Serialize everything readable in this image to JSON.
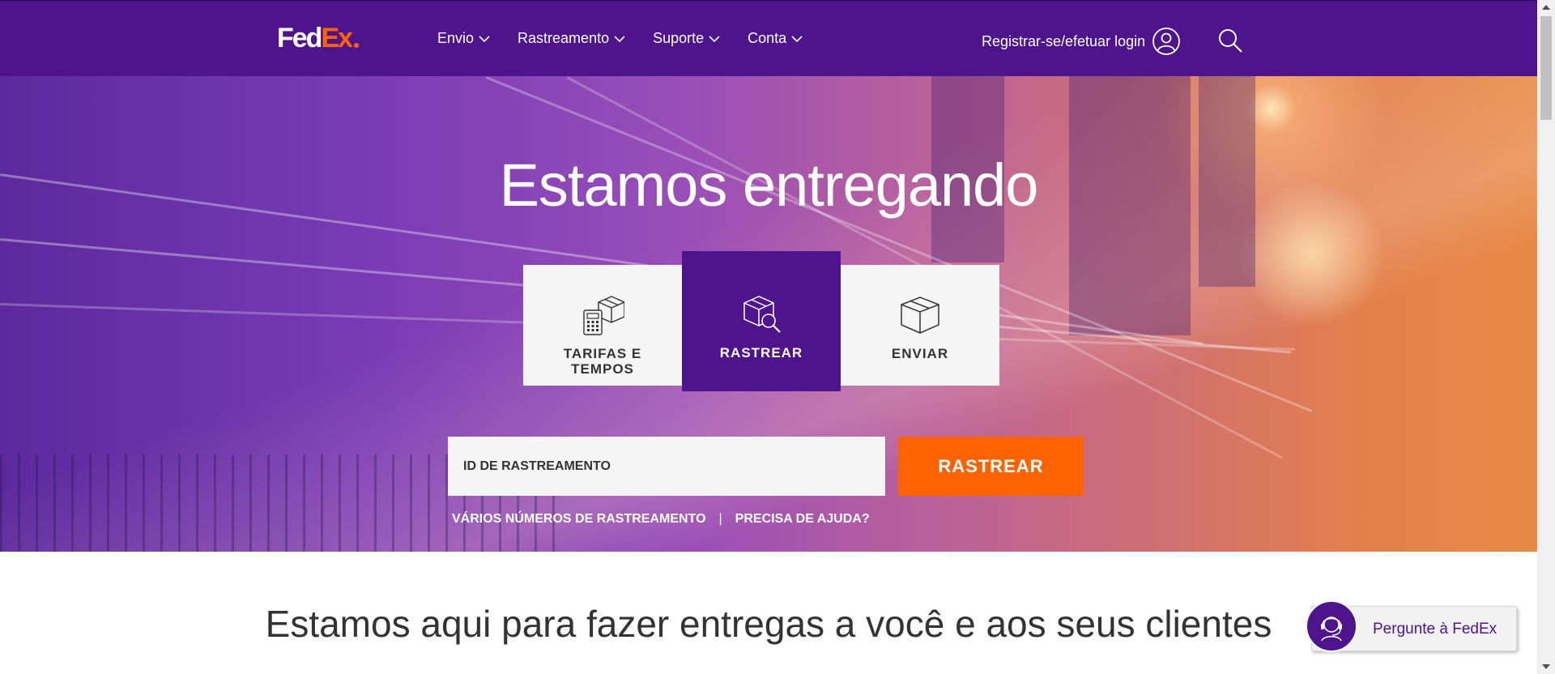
{
  "brand": {
    "logo_fed": "Fed",
    "logo_ex": "Ex",
    "purple": "#4d148c",
    "orange": "#ff6200"
  },
  "nav": {
    "items": [
      {
        "label": "Envio"
      },
      {
        "label": "Rastreamento"
      },
      {
        "label": "Suporte"
      },
      {
        "label": "Conta"
      }
    ],
    "login_label": "Registrar-se/efetuar login"
  },
  "hero": {
    "title": "Estamos entregando",
    "tabs": [
      {
        "label": "TARIFAS E TEMPOS",
        "icon": "calculator-box-icon",
        "active": false
      },
      {
        "label": "RASTREAR",
        "icon": "box-magnifier-icon",
        "active": true
      },
      {
        "label": "ENVIAR",
        "icon": "box-icon",
        "active": false
      }
    ],
    "tracking_placeholder": "ID DE RASTREAMENTO",
    "track_button": "RASTREAR",
    "links": {
      "multiple": "VÁRIOS NÚMEROS DE RASTREAMENTO",
      "separator": "|",
      "help": "PRECISA DE AJUDA?"
    }
  },
  "main": {
    "section_title": "Estamos aqui para fazer entregas a você e aos seus clientes"
  },
  "chat": {
    "label": "Pergunte à FedEx"
  }
}
